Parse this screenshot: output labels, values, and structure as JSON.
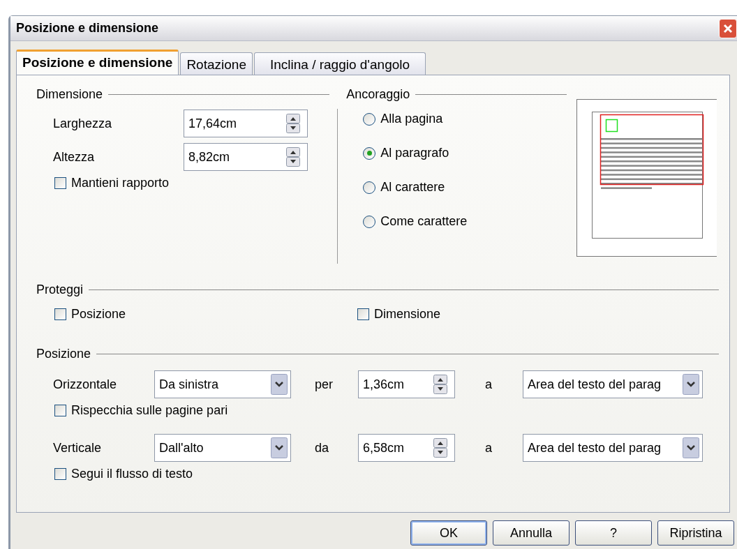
{
  "window": {
    "title": "Posizione e dimensione"
  },
  "tabs": [
    {
      "label": "Posizione e dimensione",
      "selected": true
    },
    {
      "label": "Rotazione",
      "selected": false
    },
    {
      "label": "Inclina / raggio d'angolo",
      "selected": false
    }
  ],
  "size": {
    "title": "Dimensione",
    "fields": [
      {
        "label": "Larghezza",
        "value": "17,64cm"
      },
      {
        "label": "Altezza",
        "value": "8,82cm"
      }
    ],
    "keep_ratio": {
      "label": "Mantieni rapporto",
      "checked": false
    }
  },
  "anchor": {
    "title": "Ancoraggio",
    "options": [
      {
        "label": "Alla pagina",
        "selected": false
      },
      {
        "label": "Al paragrafo",
        "selected": true
      },
      {
        "label": "Al carattere",
        "selected": false
      },
      {
        "label": "Come carattere",
        "selected": false
      }
    ]
  },
  "protect": {
    "title": "Proteggi",
    "options": [
      {
        "label": "Posizione",
        "checked": false
      },
      {
        "label": "Dimensione",
        "checked": false
      }
    ]
  },
  "position": {
    "title": "Posizione",
    "rows": [
      {
        "label": "Orizzontale",
        "mode": "Da sinistra",
        "by_label": "per",
        "offset": "1,36cm",
        "to_label": "a",
        "relative_to": "Area del testo del parag",
        "option": {
          "label": "Rispecchia sulle pagine pari",
          "checked": false
        }
      },
      {
        "label": "Verticale",
        "mode": "Dall'alto",
        "by_label": "da",
        "offset": "6,58cm",
        "to_label": "a",
        "relative_to": "Area del testo del parag",
        "option": {
          "label": "Segui il flusso di testo",
          "checked": false
        }
      }
    ]
  },
  "buttons": [
    {
      "label": "OK",
      "default": true
    },
    {
      "label": "Annulla",
      "default": false
    },
    {
      "label": "?",
      "default": false
    },
    {
      "label": "Ripristina",
      "default": false
    }
  ]
}
